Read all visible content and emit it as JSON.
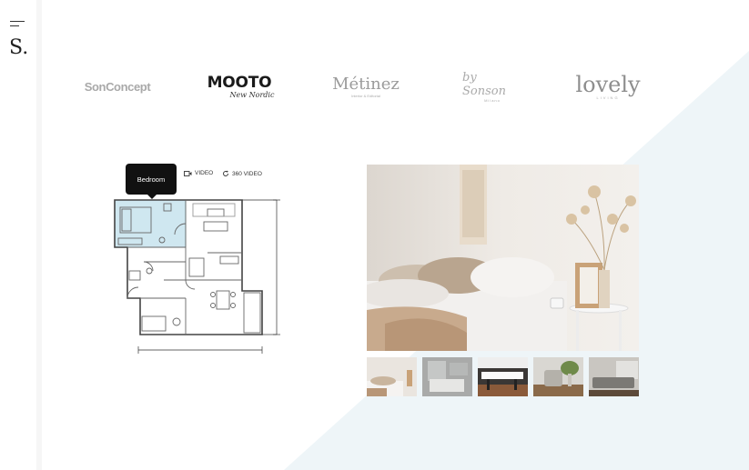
{
  "brand": {
    "letter": "S."
  },
  "logos": [
    {
      "name": "SonConcept",
      "sub": ""
    },
    {
      "name": "MOOTO",
      "sub": "New Nordic"
    },
    {
      "name": "Métinez",
      "sub": "Interior & Editorial"
    },
    {
      "name": "by Sonson",
      "sub": "Milano"
    },
    {
      "name": "lovely",
      "sub": "LIVING"
    }
  ],
  "floorplan": {
    "tooltip": "Bedroom",
    "options": [
      {
        "icon": "video-camera-icon",
        "label": "VIDEO"
      },
      {
        "icon": "rotate-360-icon",
        "label": "360 VIDEO"
      }
    ]
  },
  "gallery": {
    "main_photo": "bedroom-photo",
    "thumbnails": [
      "bedroom-thumb",
      "bathroom-thumb",
      "kitchen-thumb",
      "armchair-thumb",
      "living-room-thumb"
    ]
  },
  "colors": {
    "accent_triangle": "#eef5f8",
    "plan_highlight": "#cfe7f0",
    "tooltip_bg": "#111111"
  }
}
